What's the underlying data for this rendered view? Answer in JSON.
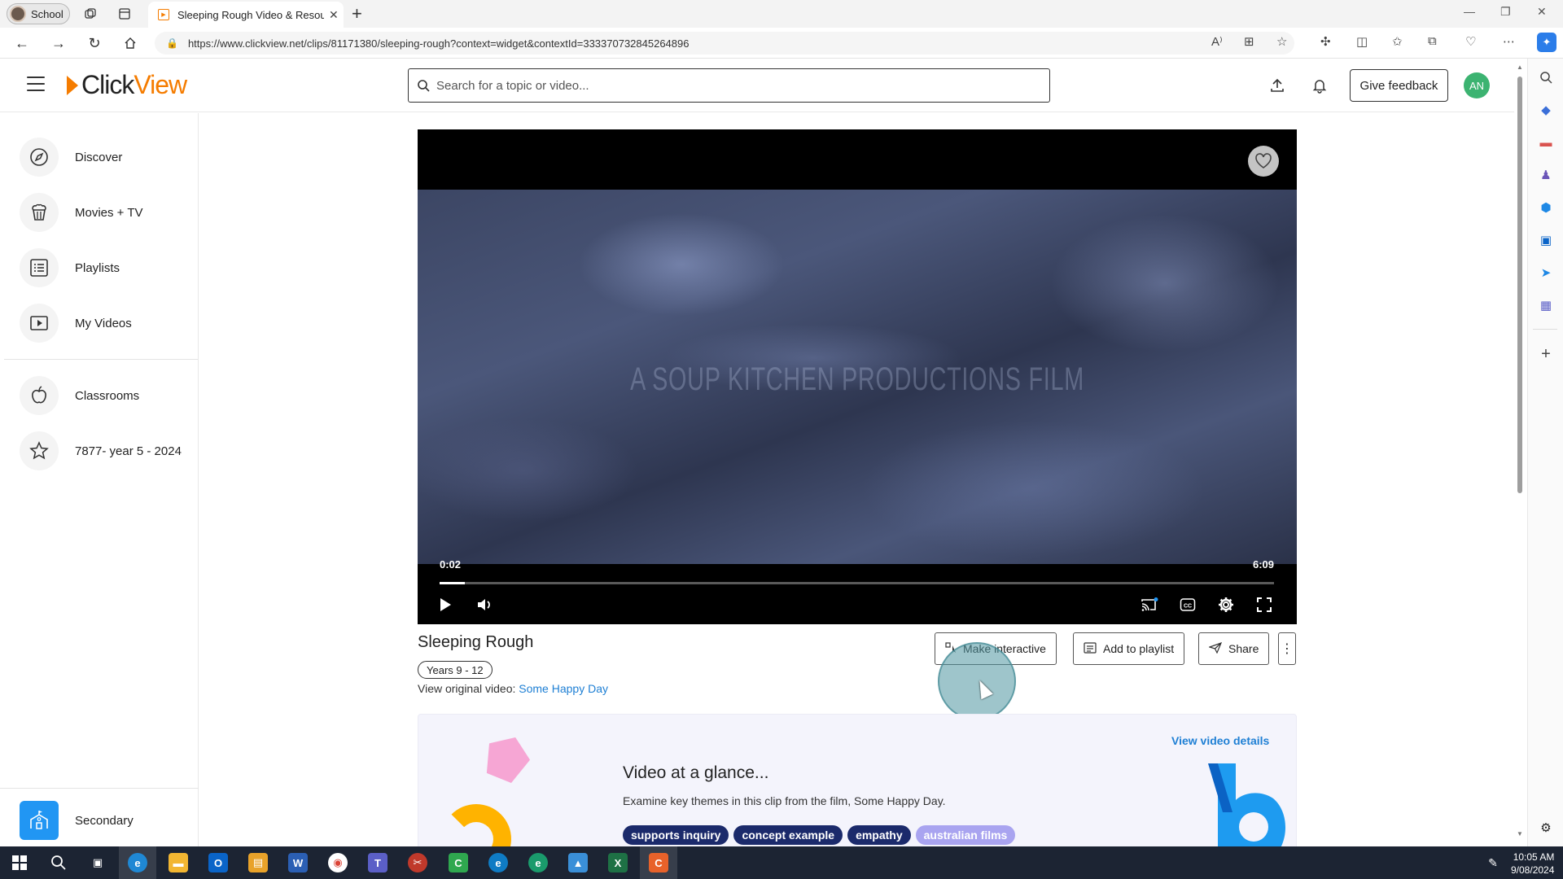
{
  "browser": {
    "profile_label": "School",
    "tab_title": "Sleeping Rough Video & Resources",
    "url": "https://www.clickview.net/clips/81171380/sleeping-rough?context=widget&contextId=333370732845264896"
  },
  "header": {
    "logo_part1": "Click",
    "logo_part2": "View",
    "search_placeholder": "Search for a topic or video...",
    "feedback_label": "Give feedback",
    "avatar_initials": "AN"
  },
  "sidebar": {
    "items": [
      {
        "label": "Discover",
        "icon": "compass-icon"
      },
      {
        "label": "Movies + TV",
        "icon": "popcorn-icon"
      },
      {
        "label": "Playlists",
        "icon": "list-icon"
      },
      {
        "label": "My Videos",
        "icon": "play-square-icon"
      },
      {
        "label": "Classrooms",
        "icon": "apple-icon"
      },
      {
        "label": "7877- year 5 - 2024",
        "icon": "star-icon"
      }
    ],
    "bottom_label": "Secondary"
  },
  "player": {
    "credit_text": "A SOUP KITCHEN PRODUCTIONS FILM",
    "current_time": "0:02",
    "duration": "6:09",
    "progress_percent": 3
  },
  "video": {
    "title": "Sleeping Rough",
    "years": "Years 9 - 12",
    "original_prefix": "View original video: ",
    "original_link": "Some Happy Day",
    "actions": {
      "interactive": "Make interactive",
      "playlist": "Add to playlist",
      "share": "Share"
    }
  },
  "glance": {
    "title": "Video at a glance...",
    "description": "Examine key themes in this clip from the film, Some Happy Day.",
    "details_link": "View video details",
    "tags": [
      "supports inquiry",
      "concept example",
      "empathy",
      "australian films"
    ]
  },
  "taskbar": {
    "time": "10:05 AM",
    "date": "9/08/2024"
  },
  "colors": {
    "brand_orange": "#f57c00",
    "link_blue": "#1e7fd4",
    "tag_navy": "#1b2a6b",
    "tag_lavender": "#a9a4f0"
  }
}
